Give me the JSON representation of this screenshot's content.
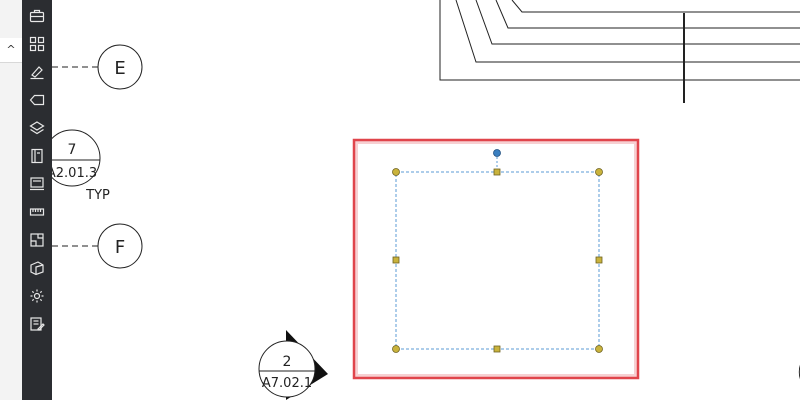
{
  "sidebar": {
    "caret": "^",
    "tools": [
      {
        "icon": "briefcase-icon"
      },
      {
        "icon": "grid-icon"
      },
      {
        "icon": "pen-markup-icon"
      },
      {
        "icon": "tag-icon"
      },
      {
        "icon": "layers-icon"
      },
      {
        "icon": "book-icon"
      },
      {
        "icon": "monitor-icon"
      },
      {
        "icon": "ruler-icon"
      },
      {
        "icon": "floorplan-icon"
      },
      {
        "icon": "shape-icon"
      },
      {
        "icon": "gear-icon"
      },
      {
        "icon": "edit-list-icon"
      }
    ]
  },
  "drawing": {
    "grid_e": "E",
    "grid_f": "F",
    "callout_top": {
      "number": "7",
      "sheet": "A2.01.3",
      "note": "TYP"
    },
    "callout_bottom": {
      "number": "2",
      "sheet": "A7.02.1"
    }
  },
  "colors": {
    "toolbar_bg": "#2b2d31",
    "highlight_border": "#e0454b",
    "selection_dash": "#5b9bd5",
    "grip": "#c9b33c",
    "rotate_grip": "#3a7fc0",
    "linework": "#222222"
  }
}
